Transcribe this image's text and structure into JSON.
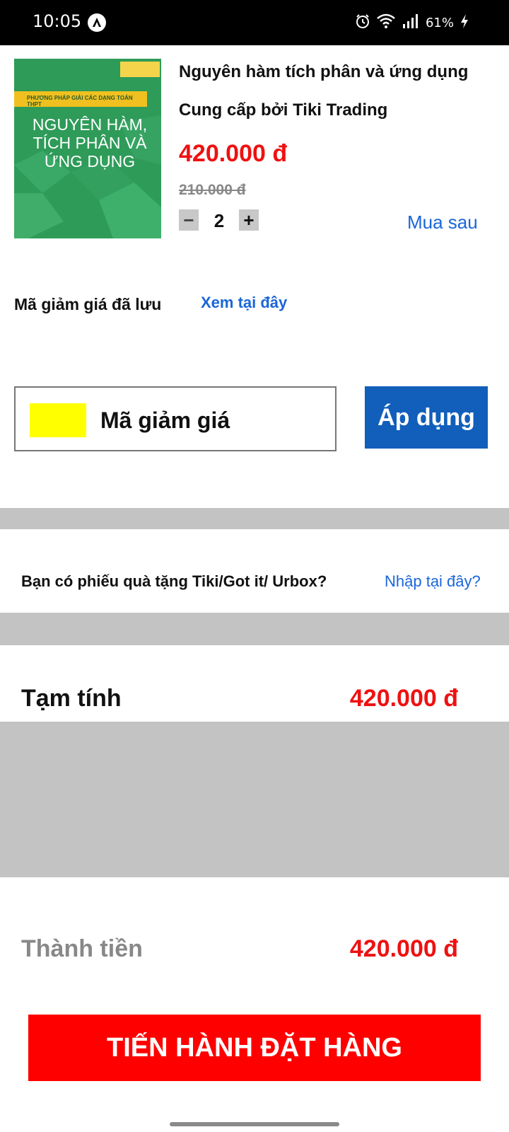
{
  "status_bar": {
    "time": "10:05",
    "battery": "61%",
    "icons": [
      "app-icon",
      "alarm-icon",
      "wifi-icon",
      "signal-icon",
      "battery-charging-icon"
    ]
  },
  "product": {
    "image_icon": "book-cover-image",
    "cover_title": "NGUYÊN HÀM, TÍCH PHÂN VÀ ỨNG DỤNG",
    "cover_subtitle": "PHƯƠNG PHÁP GIẢI CÁC DẠNG TOÁN THPT",
    "name": "Nguyên hàm tích phân và ứng dụng",
    "provider": "Cung cấp bởi Tiki Trading",
    "price": "420.000 đ",
    "old_price": "210.000 đ",
    "quantity": "2",
    "minus_label": "−",
    "plus_label": "+",
    "buy_later": "Mua sau"
  },
  "coupon": {
    "saved_label": "Mã giảm giá đã lưu",
    "saved_link": "Xem tại đây",
    "input_placeholder": "Mã giảm giá",
    "apply_label": "Áp dụng",
    "icon_color": "#ffff00",
    "apply_color": "#115ebb"
  },
  "gift": {
    "label": "Bạn có phiếu quà tặng Tiki/Got it/ Urbox?",
    "link": "Nhập tại đây?"
  },
  "summary": {
    "subtotal_label": "Tạm tính",
    "subtotal_value": "420.000 đ",
    "total_label": "Thành tiền",
    "total_value": "420.000 đ"
  },
  "checkout": {
    "label": "TIẾN HÀNH ĐẶT HÀNG",
    "color": "#ff0000"
  }
}
